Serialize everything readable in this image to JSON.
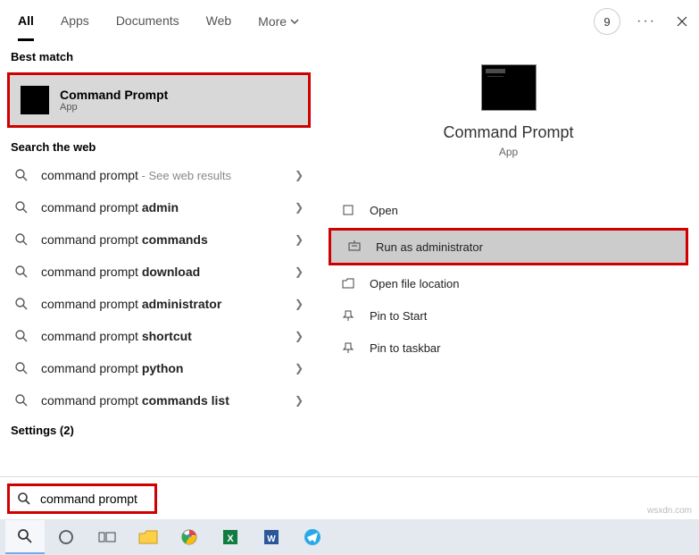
{
  "topbar": {
    "tabs": {
      "all": "All",
      "apps": "Apps",
      "documents": "Documents",
      "web": "Web",
      "more": "More"
    },
    "badge": "9"
  },
  "left": {
    "best_hdr": "Best match",
    "best": {
      "title": "Command Prompt",
      "sub": "App"
    },
    "web_hdr": "Search the web",
    "rows": [
      {
        "p": "command prompt",
        "b": "",
        "hint": " - See web results"
      },
      {
        "p": "command prompt ",
        "b": "admin",
        "hint": ""
      },
      {
        "p": "command prompt ",
        "b": "commands",
        "hint": ""
      },
      {
        "p": "command prompt ",
        "b": "download",
        "hint": ""
      },
      {
        "p": "command prompt ",
        "b": "administrator",
        "hint": ""
      },
      {
        "p": "command prompt ",
        "b": "shortcut",
        "hint": ""
      },
      {
        "p": "command prompt ",
        "b": "python",
        "hint": ""
      },
      {
        "p": "command prompt ",
        "b": "commands list",
        "hint": ""
      }
    ],
    "settings_hdr": "Settings (2)"
  },
  "right": {
    "title": "Command Prompt",
    "sub": "App",
    "actions": {
      "open": "Open",
      "run_admin": "Run as administrator",
      "open_loc": "Open file location",
      "pin_start": "Pin to Start",
      "pin_task": "Pin to taskbar"
    }
  },
  "search": {
    "value": "command prompt"
  },
  "watermark": "wsxdn.com"
}
